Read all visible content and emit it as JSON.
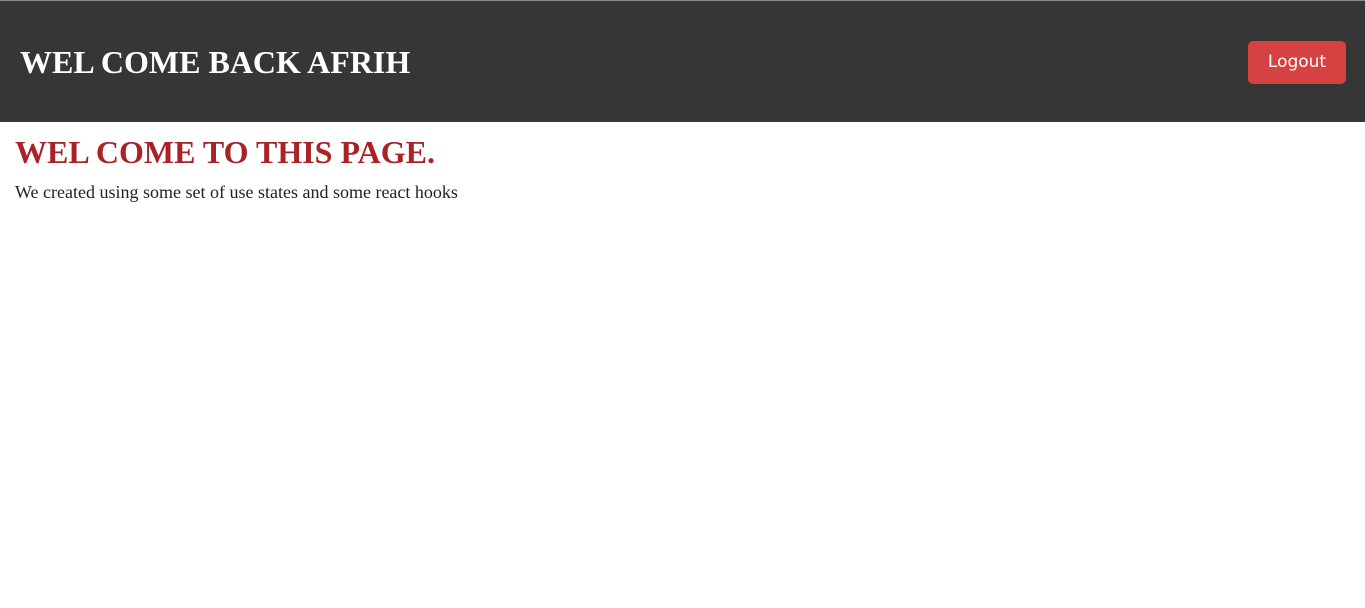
{
  "header": {
    "title": "WEL COME BACK AFRIH",
    "logout_label": "Logout"
  },
  "main": {
    "heading": "WEL COME TO THIS PAGE.",
    "description": "We created using some set of use states and some react hooks"
  },
  "colors": {
    "header_background": "#363636",
    "logout_button": "#d64141",
    "heading_accent": "#a92226"
  }
}
